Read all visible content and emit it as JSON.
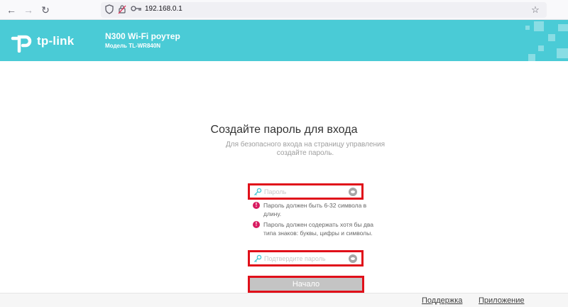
{
  "browser": {
    "url": "192.168.0.1",
    "icons": [
      "back-icon",
      "forward-icon",
      "reload-icon",
      "shield-icon",
      "lock-icon",
      "key-icon",
      "star-icon"
    ]
  },
  "header": {
    "logo_text": "tp-link",
    "model_title": "N300 Wi-Fi роутер",
    "model_subtitle": "Модель TL-WR840N",
    "background_color": "#4acbd6"
  },
  "main": {
    "title": "Создайте пароль для входа",
    "subtitle": "Для безопасного входа на страницу управления создайте пароль.",
    "password_field": {
      "placeholder": "Пароль",
      "value": ""
    },
    "errors": [
      "Пароль должен быть 6-32 символа в длину.",
      "Пароль должен содержать хотя бы два типа знаков: буквы, цифры и символы."
    ],
    "confirm_field": {
      "placeholder": "Подтвердите пароль",
      "value": ""
    },
    "start_button": "Начало",
    "highlight_color": "#e0101a"
  },
  "footer": {
    "support_link": "Поддержка",
    "app_link": "Приложение"
  }
}
